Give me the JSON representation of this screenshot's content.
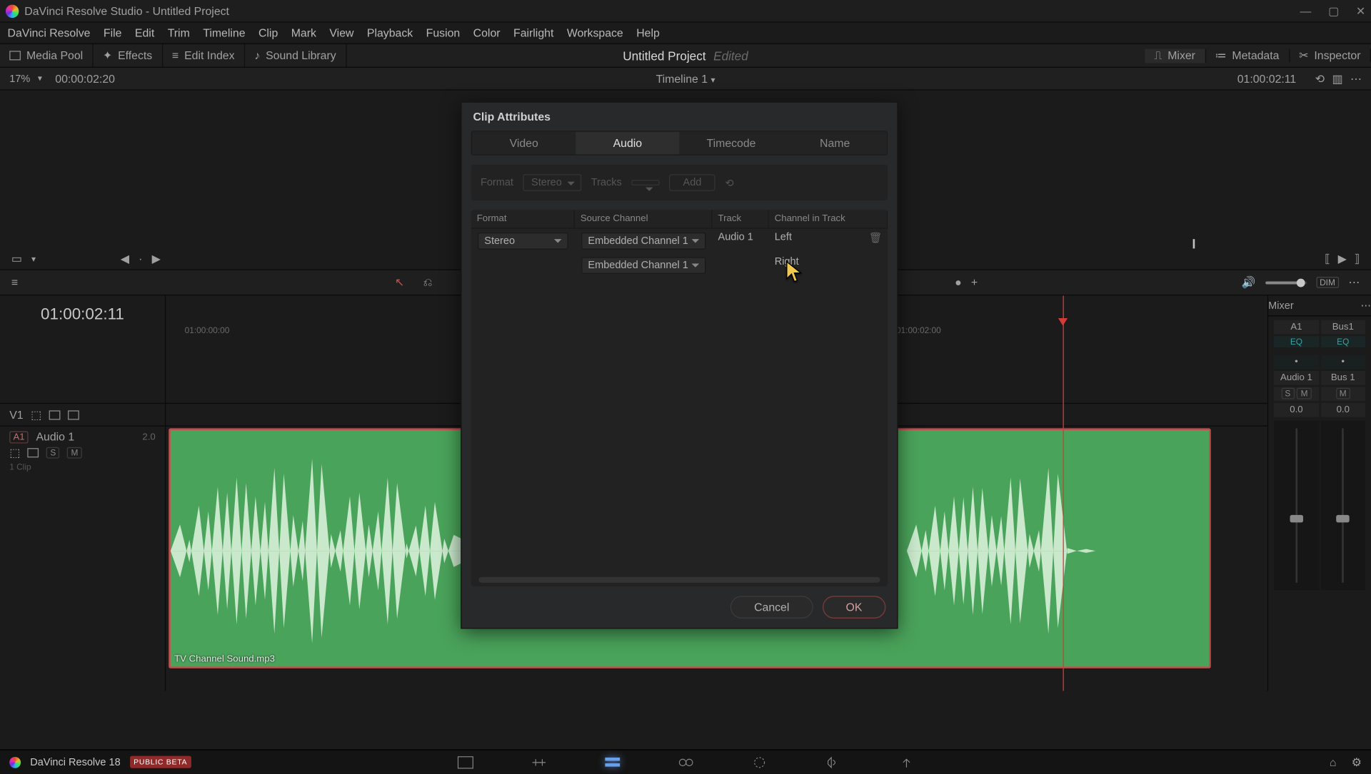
{
  "title": "DaVinci Resolve Studio - Untitled Project",
  "menu": [
    "DaVinci Resolve",
    "File",
    "Edit",
    "Trim",
    "Timeline",
    "Clip",
    "Mark",
    "View",
    "Playback",
    "Fusion",
    "Color",
    "Fairlight",
    "Workspace",
    "Help"
  ],
  "toolbar": {
    "media_pool": "Media Pool",
    "effects": "Effects",
    "edit_index": "Edit Index",
    "sound_library": "Sound Library",
    "mixer": "Mixer",
    "metadata": "Metadata",
    "inspector": "Inspector"
  },
  "project": {
    "name": "Untitled Project",
    "status": "Edited"
  },
  "timeline": {
    "name": "Timeline 1",
    "zoom": "17%",
    "left_tc": "00:00:02:20",
    "right_tc": "01:00:02:11"
  },
  "playhead_tc": "01:00:02:11",
  "tracks": {
    "video": "V1",
    "audio": {
      "badge": "A1",
      "name": "Audio 1",
      "pan": "2.0",
      "clips": "1 Clip"
    }
  },
  "ruler_ticks": {
    "t0": "01:00:00:00",
    "t2": "01:00:02:00"
  },
  "clip_name": "TV Channel Sound.mp3",
  "mixer_panel": {
    "title": "Mixer",
    "a1": "A1",
    "bus1": "Bus1",
    "eq": "EQ",
    "audio1": "Audio 1",
    "bus1b": "Bus 1",
    "s": "S",
    "m": "M",
    "zero": "0.0"
  },
  "toolrow": {
    "dim": "DIM"
  },
  "dialog": {
    "title": "Clip Attributes",
    "tabs": {
      "video": "Video",
      "audio": "Audio",
      "timecode": "Timecode",
      "name": "Name"
    },
    "formatbar": {
      "format": "Format",
      "format_val": "Stereo",
      "tracks": "Tracks",
      "add": "Add"
    },
    "headers": {
      "format": "Format",
      "source": "Source Channel",
      "track": "Track",
      "cit": "Channel in Track"
    },
    "rows": {
      "fmt": "Stereo",
      "src1": "Embedded Channel 1",
      "src2": "Embedded Channel 1",
      "trk": "Audio 1",
      "cit1": "Left",
      "cit2": "Right"
    },
    "cancel": "Cancel",
    "ok": "OK"
  },
  "bottom": {
    "app": "DaVinci Resolve 18",
    "beta": "PUBLIC BETA"
  }
}
